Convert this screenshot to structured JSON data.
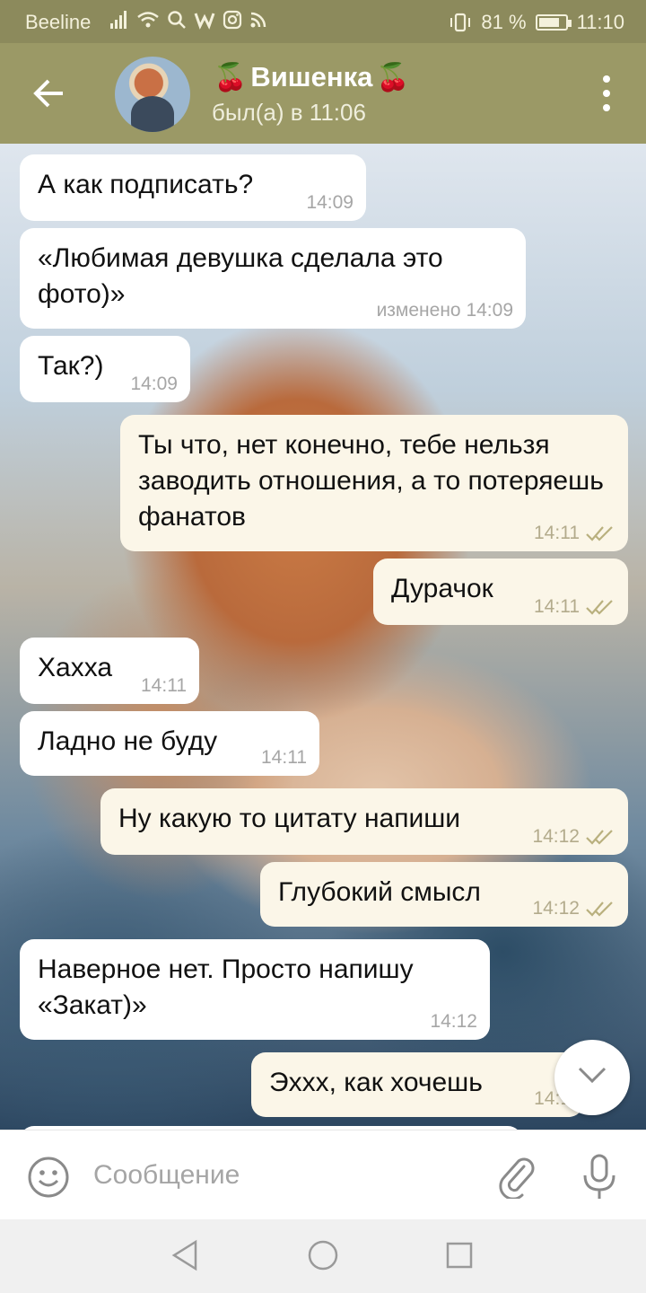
{
  "status_bar": {
    "carrier": "Beeline",
    "battery_text": "81 %",
    "battery_level": 0.81,
    "time": "11:10"
  },
  "header": {
    "back_icon": "arrow-left-icon",
    "name": "Вишенка",
    "name_decoration": "🍒",
    "last_seen": "был(а) в 11:06",
    "menu_icon": "more-vertical-icon"
  },
  "messages": [
    {
      "direction": "in",
      "text": "А как подписать?",
      "time": "14:09"
    },
    {
      "direction": "in",
      "text": "«Любимая девушка сделала это фото)»",
      "time": "изменено 14:09"
    },
    {
      "direction": "in",
      "text": "Так?)",
      "time": "14:09"
    },
    {
      "direction": "out",
      "text": "Ты что, нет конечно, тебе нельзя заводить отношения, а то потеряешь фанатов",
      "time": "14:11",
      "read": true
    },
    {
      "direction": "out",
      "text": "Дурачок",
      "time": "14:11",
      "read": true
    },
    {
      "direction": "in",
      "text": "Хахха",
      "time": "14:11"
    },
    {
      "direction": "in",
      "text": "Ладно не буду",
      "time": "14:11"
    },
    {
      "direction": "out",
      "text": "Ну какую то цитату напиши",
      "time": "14:12",
      "read": true
    },
    {
      "direction": "out",
      "text": "Глубокий смысл",
      "time": "14:12",
      "read": true
    },
    {
      "direction": "in",
      "text": "Наверное нет. Просто напишу «Закат)»",
      "time": "14:12"
    },
    {
      "direction": "out",
      "text": "Эххх, как хочешь",
      "time": "14:1",
      "read": true
    }
  ],
  "scroll_down_icon": "chevron-down-icon",
  "input_bar": {
    "emoji_icon": "smiley-icon",
    "placeholder": "Сообщение",
    "attach_icon": "paperclip-icon",
    "mic_icon": "microphone-icon"
  },
  "nav_bar": {
    "back_icon": "triangle-back-icon",
    "home_icon": "circle-home-icon",
    "recents_icon": "square-recents-icon"
  }
}
